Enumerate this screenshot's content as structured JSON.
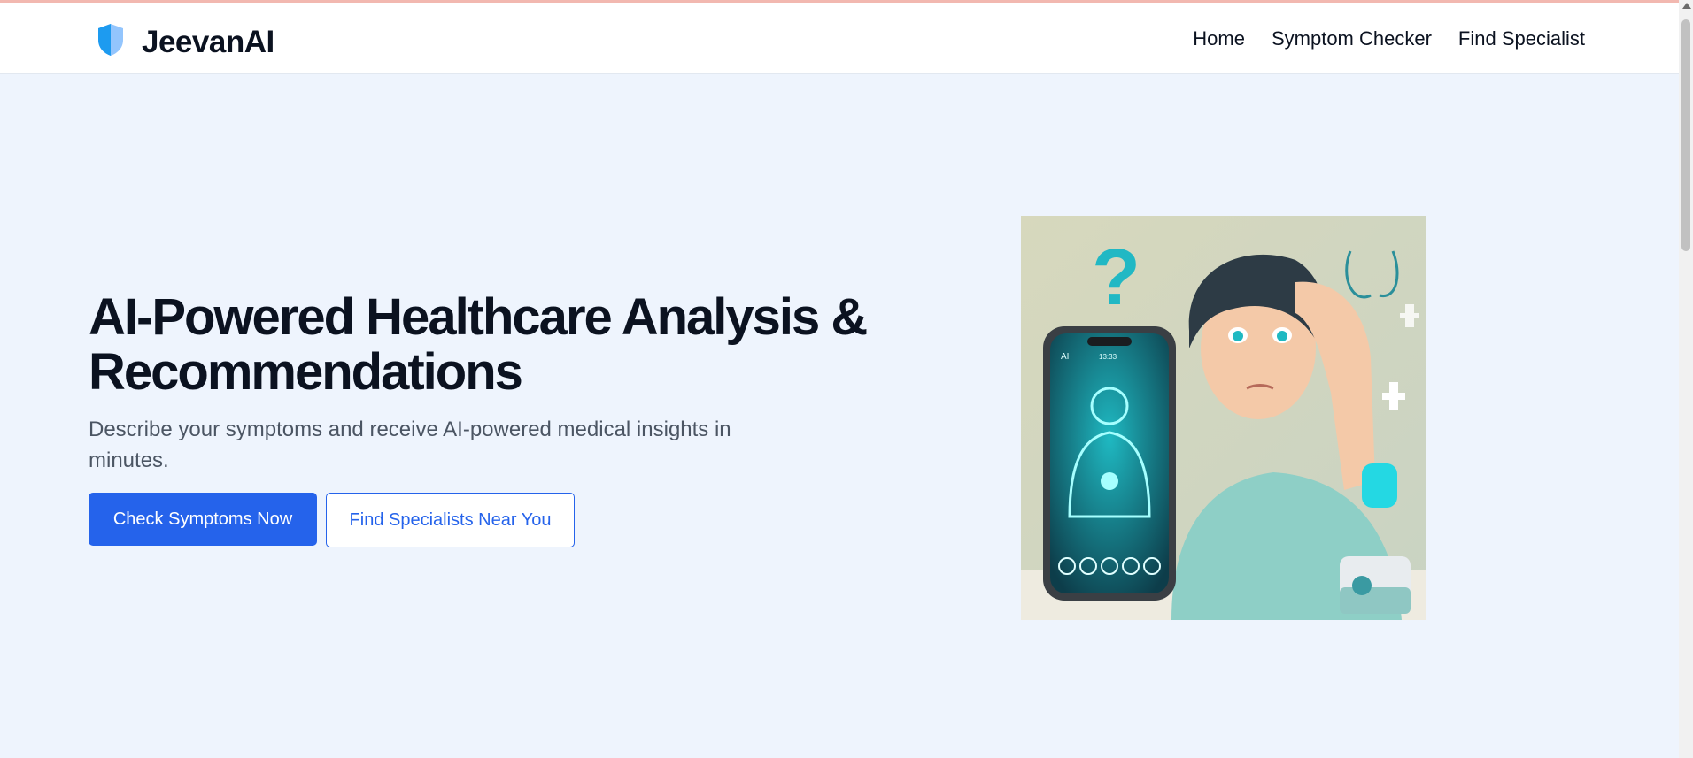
{
  "brand": {
    "name": "JeevanAI",
    "logo_icon": "shield-icon",
    "accent_color": "#2563eb"
  },
  "nav": {
    "home": "Home",
    "symptom_checker": "Symptom Checker",
    "find_specialist": "Find Specialist"
  },
  "hero": {
    "title": "AI-Powered Healthcare Analysis & Recommendations",
    "subtitle": "Describe your symptoms and receive AI-powered medical insights in minutes.",
    "primary_button": "Check Symptoms Now",
    "secondary_button": "Find Specialists Near You",
    "image": {
      "phone_label": "AI",
      "phone_time": "13:33",
      "question_mark": "?"
    }
  }
}
